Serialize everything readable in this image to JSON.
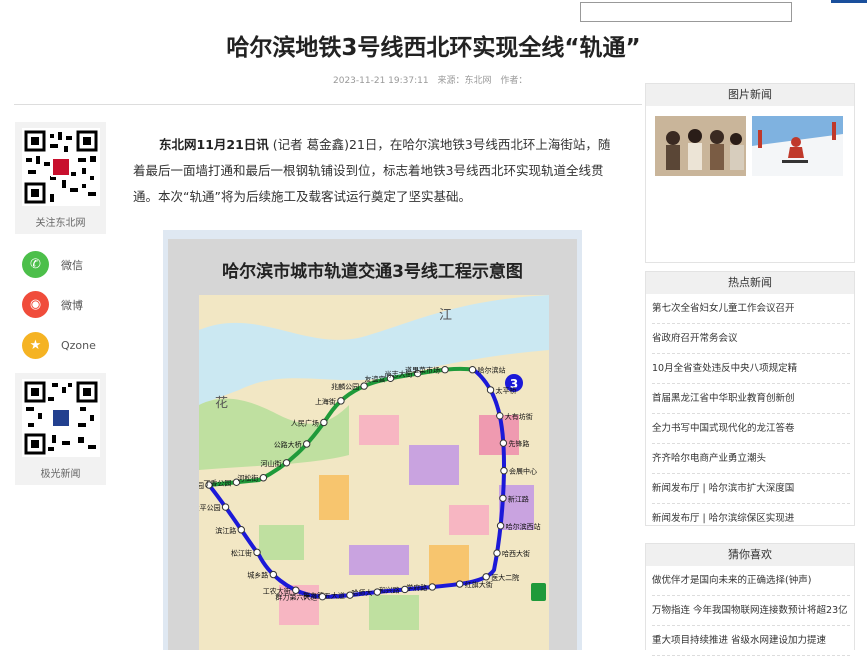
{
  "header": {
    "search_placeholder": ""
  },
  "article": {
    "title": "哈尔滨地铁3号线西北环实现全线“轨通”",
    "datetime": "2023-11-21 19:37:11",
    "source_label": "来源：东北网",
    "author_label": "作者：",
    "lead_bold": "东北网11月21日讯",
    "body_text": " (记者 葛金鑫)21日，在哈尔滨地铁3号线西北环上海街站，随着最后一面墙打通和最后一根钢轨铺设到位，标志着地铁3号线西北环实现轨道全线贯通。本次“轨通”将为后续施工及载客试运行奠定了坚实基础。"
  },
  "left_rail": {
    "follow_caption": "关注东北网",
    "share": [
      {
        "label": "微信",
        "color": "#4cbf4a",
        "icon": "wechat-icon"
      },
      {
        "label": "微博",
        "color": "#f04c3b",
        "icon": "weibo-icon"
      },
      {
        "label": "Qzone",
        "color": "#f5b323",
        "icon": "qzone-icon"
      }
    ],
    "app_caption": "极光新闻"
  },
  "map": {
    "title": "哈尔滨市城市轨道交通3号线工程示意图",
    "line_number": "3",
    "river_label_1": "江",
    "river_label_2": "花",
    "stations": [
      "体育公园",
      "丁香公园",
      "河松街",
      "河山街",
      "公路大桥",
      "人民广场",
      "上海街",
      "兆麟公园",
      "友谊宫",
      "尚志大街",
      "道里菜市场",
      "哈尔滨站",
      "太平桥",
      "大有坊街",
      "先锋路",
      "会展中心",
      "新江路",
      "哈尔滨西站",
      "哈西大街",
      "医大二院",
      "红旗大街",
      "学府路",
      "和兴路",
      "哈师大",
      "群力第五大道",
      "群力第六大道",
      "工农大街",
      "城乡路",
      "松江街",
      "滨江路",
      "太平公园"
    ]
  },
  "right_rail": {
    "photo_news_title": "图片新闻",
    "hot_news_title": "热点新闻",
    "hot_news": [
      "第七次全省妇女儿童工作会议召开",
      "省政府召开常务会议",
      "10月全省查处违反中央八项规定精",
      "首届黑龙江省中华职业教育创新创",
      "全力书写中国式现代化的龙江答卷",
      "齐齐哈尔电商产业勇立潮头",
      "新闻发布厅 | 哈尔滨市扩大深度国",
      "新闻发布厅 | 哈尔滨综保区实现进"
    ],
    "like_title": "猜你喜欢",
    "like_news": [
      "做优伴才是国向未来的正确选择(钟声)",
      "万物指连 今年我国物联网连接数预计将超23亿",
      "重大项目持续推进 省级水网建设加力提速"
    ]
  },
  "colors": {
    "line_blue": "#1c19d8",
    "line_green": "#1f9a3a",
    "accent": "#1a4f9c"
  }
}
